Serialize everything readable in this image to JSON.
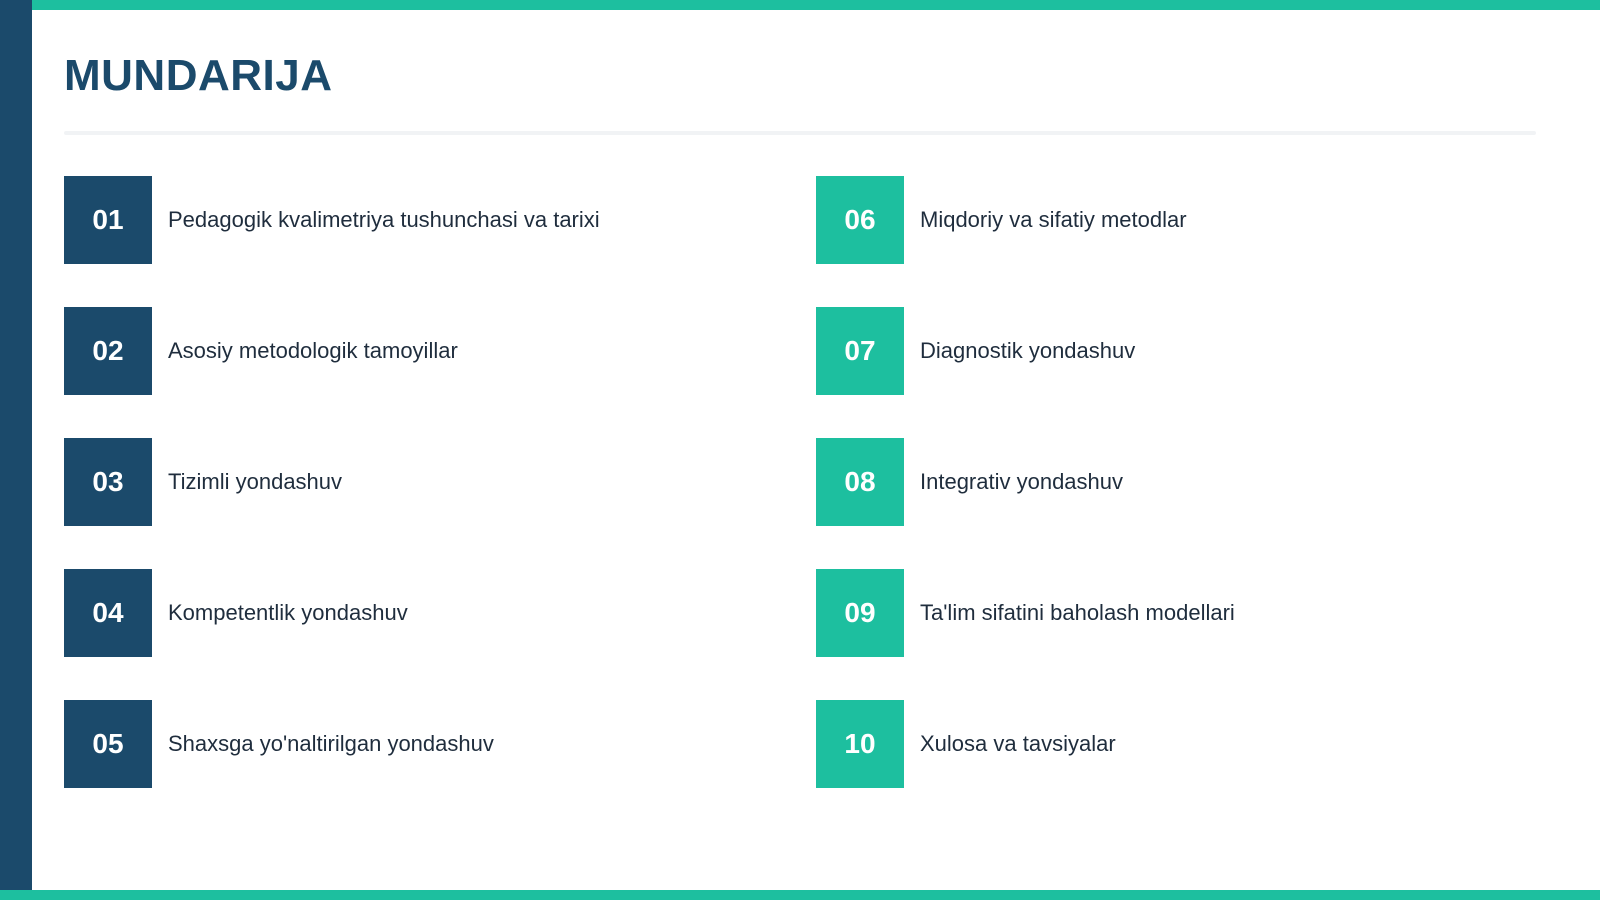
{
  "title": "MUNDARIJA",
  "colors": {
    "primary_dark": "#1b4a6b",
    "accent_teal": "#1dbf9f",
    "title_color": "#1b4a6b"
  },
  "toc": {
    "items": [
      {
        "number": "01",
        "label": "Pedagogik kvalimetriya tushunchasi va tarixi",
        "style": "dark"
      },
      {
        "number": "02",
        "label": "Asosiy metodologik tamoyillar",
        "style": "dark"
      },
      {
        "number": "03",
        "label": "Tizimli yondashuv",
        "style": "dark"
      },
      {
        "number": "04",
        "label": "Kompetentlik yondashuv",
        "style": "dark"
      },
      {
        "number": "05",
        "label": "Shaxsga yo'naltirilgan yondashuv",
        "style": "dark"
      },
      {
        "number": "06",
        "label": "Miqdoriy va sifatiy metodlar",
        "style": "teal"
      },
      {
        "number": "07",
        "label": "Diagnostik yondashuv",
        "style": "teal"
      },
      {
        "number": "08",
        "label": "Integrativ yondashuv",
        "style": "teal"
      },
      {
        "number": "09",
        "label": "Ta'lim sifatini baholash modellari",
        "style": "teal"
      },
      {
        "number": "10",
        "label": "Xulosa va tavsiyalar",
        "style": "teal"
      }
    ]
  }
}
